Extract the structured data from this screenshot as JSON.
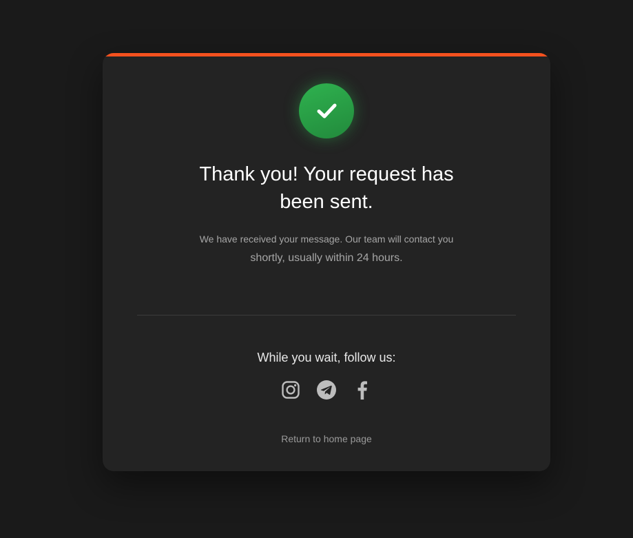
{
  "card": {
    "accent_color": "#f4511e",
    "success_icon": "check-icon",
    "success_color": "#2fb24f",
    "title_line1": "Thank you! Your request has",
    "title_line2": "been sent.",
    "message_line1": "We have received your message. Our team will contact you",
    "message_line2": "shortly, usually within 24 hours.",
    "follow_label": "While you wait, follow us:",
    "socials": [
      {
        "icon": "instagram-icon"
      },
      {
        "icon": "telegram-icon"
      },
      {
        "icon": "facebook-icon"
      }
    ],
    "home_link": "Return to home page"
  }
}
